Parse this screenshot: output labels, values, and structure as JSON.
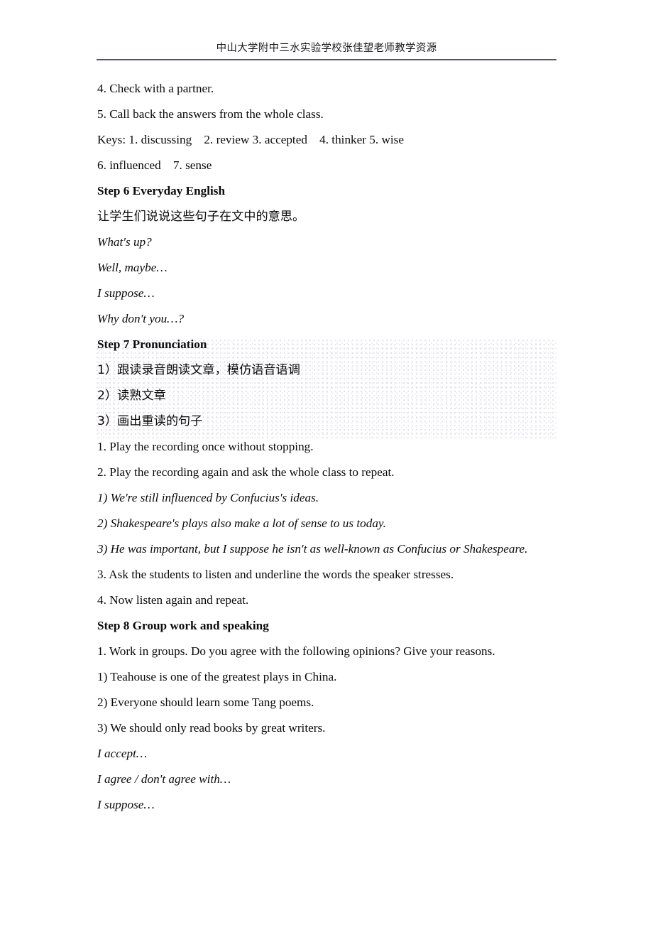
{
  "document": {
    "header": {
      "title": "中山大学附中三水实验学校张佳望老师教学资源"
    },
    "colors": {
      "text": "#0a0a0a",
      "keys_red": "#ff0000",
      "header_rule": "#56526b",
      "shade_background": "#f7f4f8"
    },
    "content": {
      "step5_items": [
        "4. Check with a partner.",
        "5. Call back the answers from the whole class."
      ],
      "keys": {
        "line1": "Keys: 1. discussing    2. review 3. accepted    4. thinker 5. wise",
        "line2": "6. influenced    7. sense"
      },
      "step6": {
        "heading": "Step 6 Everyday English",
        "instruction_cn": "让学生们说说这些句子在文中的意思。",
        "phrases": [
          "What's up?",
          "Well, maybe…",
          "I suppose…",
          "Why don't you…?"
        ]
      },
      "step7": {
        "heading": "Step 7 Pronunciation",
        "cn_items": [
          "1）跟读录音朗读文章，模仿语音语调",
          "2）读熟文章",
          "3）画出重读的句子"
        ],
        "steps": [
          "1. Play the recording once without stopping.",
          "2. Play the recording again and ask the whole class to repeat."
        ],
        "sentences": [
          "1) We're still influenced by Confucius's ideas.",
          "2) Shakespeare's plays also make a lot of sense to us today.",
          "3) He was important, but I suppose he isn't as well-known as Confucius or Shakespeare."
        ],
        "steps_after": [
          "3. Ask the students to listen and underline the words the speaker stresses.",
          "4. Now listen again and repeat."
        ]
      },
      "step8": {
        "heading": "Step 8 Group work and speaking",
        "instruction": "1. Work in groups. Do you agree with the following opinions? Give your reasons.",
        "opinions": [
          "1) Teahouse is one of the greatest plays in China.",
          "2) Everyone should learn some Tang poems.",
          "3) We should only read books by great writers."
        ],
        "phrases": [
          "I accept…",
          "I agree / don't agree with…",
          "I suppose…"
        ]
      }
    }
  }
}
